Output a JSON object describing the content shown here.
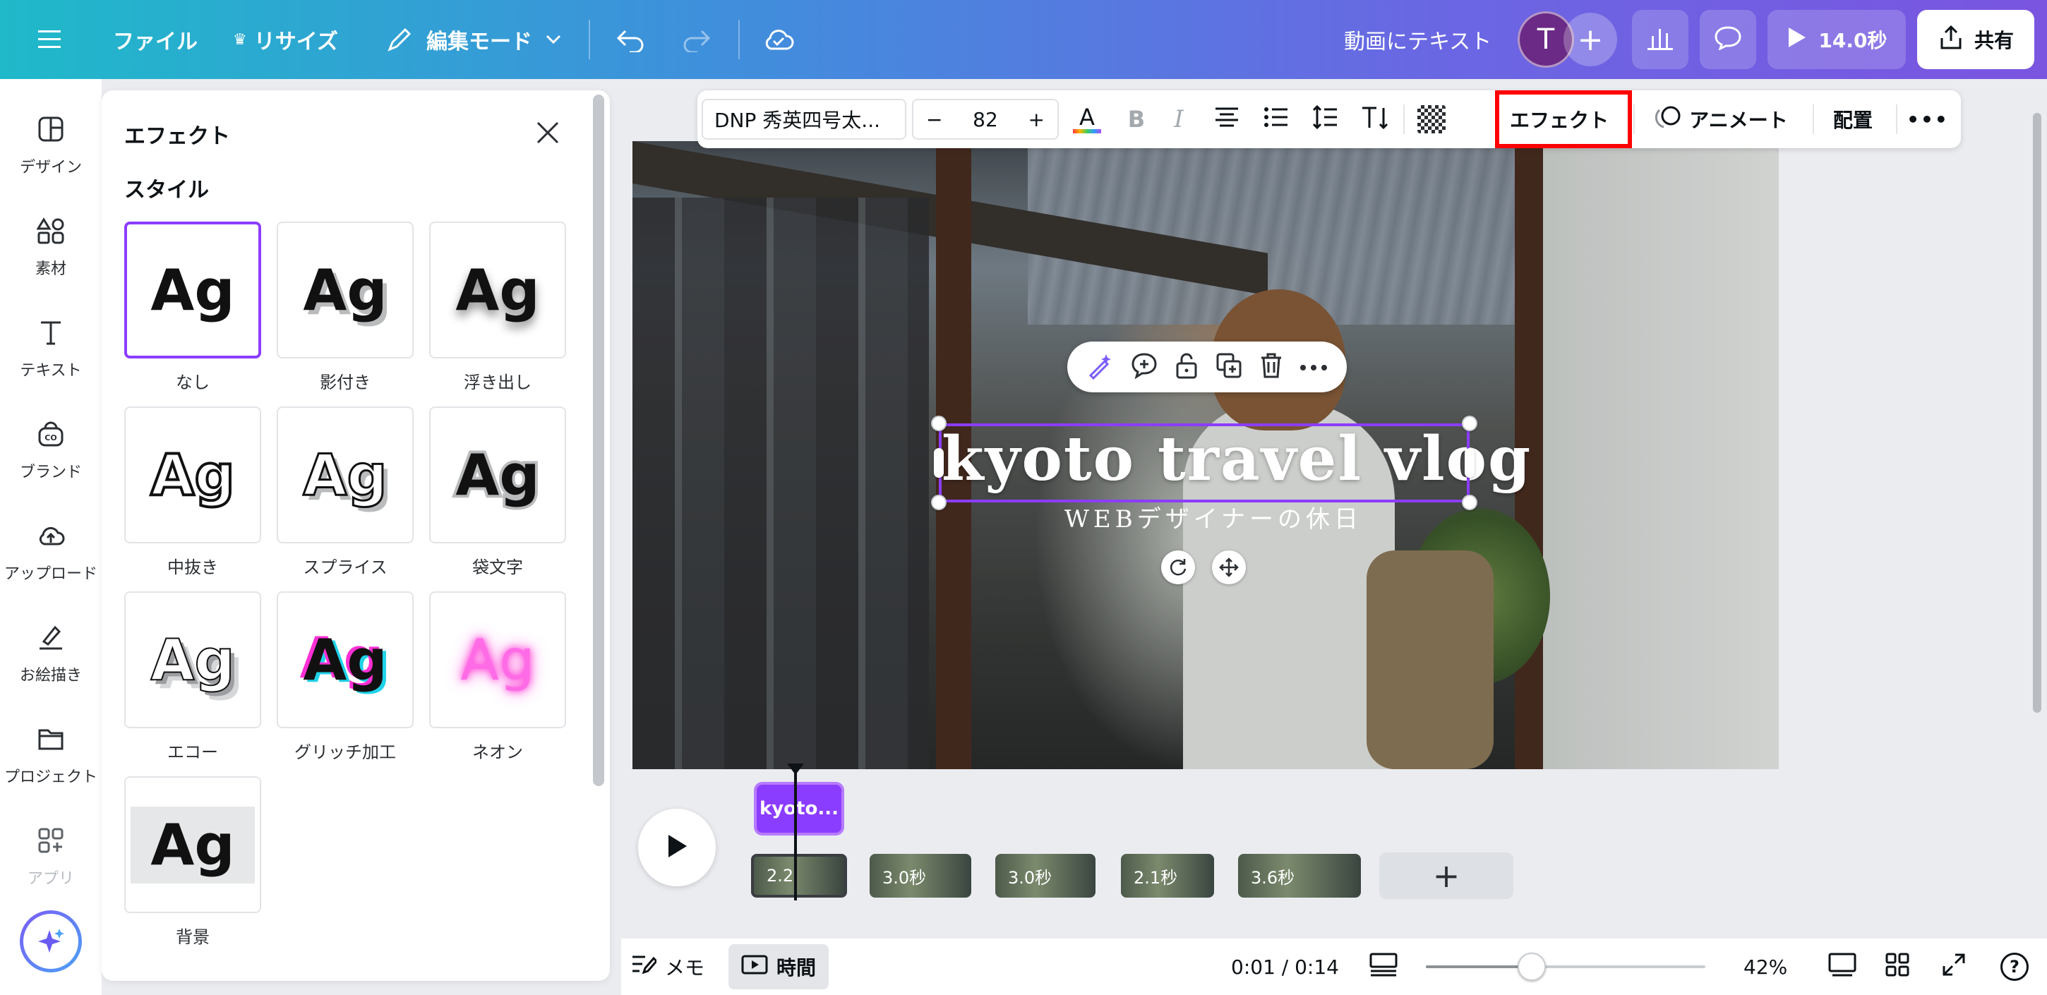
{
  "topbar": {
    "file": "ファイル",
    "resize": "リサイズ",
    "edit_mode": "編集モード",
    "doc_title": "動画にテキスト",
    "avatar_initial": "T",
    "duration": "14.0秒",
    "share": "共有"
  },
  "rail": {
    "items": [
      "デザイン",
      "素材",
      "テキスト",
      "ブランド",
      "アップロード",
      "お絵描き",
      "プロジェクト",
      "アプリ"
    ]
  },
  "panel": {
    "title": "エフェクト",
    "section": "スタイル",
    "styles": [
      {
        "label": "なし",
        "sample": "Ag"
      },
      {
        "label": "影付き",
        "sample": "Ag"
      },
      {
        "label": "浮き出し",
        "sample": "Ag"
      },
      {
        "label": "中抜き",
        "sample": "Ag"
      },
      {
        "label": "スプライス",
        "sample": "Ag"
      },
      {
        "label": "袋文字",
        "sample": "Ag"
      },
      {
        "label": "エコー",
        "sample": "Ag"
      },
      {
        "label": "グリッチ加工",
        "sample": "Ag"
      },
      {
        "label": "ネオン",
        "sample": "Ag"
      },
      {
        "label": "背景",
        "sample": "Ag"
      }
    ]
  },
  "text_toolbar": {
    "font": "DNP 秀英四号太...",
    "minus": "−",
    "size": "82",
    "plus": "+",
    "font_color_icon": "A",
    "bold": "B",
    "italic": "I",
    "effect": "エフェクト",
    "animate": "アニメート",
    "position": "配置",
    "more": "•••"
  },
  "canvas": {
    "title": "kyoto travel vlog",
    "subtitle": "WEBデザイナーの休日"
  },
  "timeline": {
    "text_clip": "kyoto...",
    "clips": [
      "2.2",
      "3.0秒",
      "3.0秒",
      "2.1秒",
      "3.6秒"
    ],
    "add": "+"
  },
  "bottombar": {
    "notes": "メモ",
    "time": "時間",
    "timecode": "0:01 / 0:14",
    "zoom": "42%",
    "help": "?"
  }
}
